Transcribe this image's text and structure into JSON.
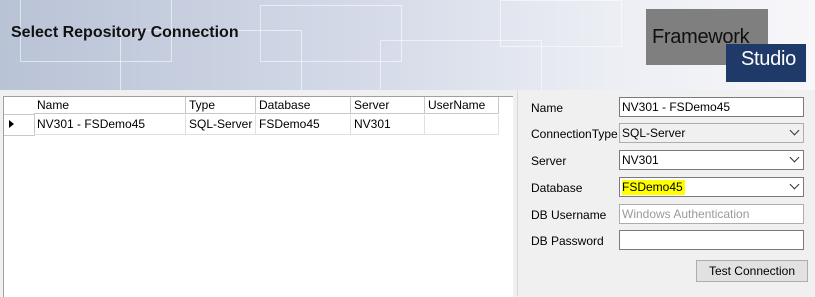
{
  "header": {
    "title": "Select Repository Connection",
    "logo_line1": "Framework",
    "logo_line2": "Studio"
  },
  "grid": {
    "columns": [
      "Name",
      "Type",
      "Database",
      "Server",
      "UserName"
    ],
    "rows": [
      [
        "NV301 - FSDemo45",
        "SQL-Server",
        "FSDemo45",
        "NV301",
        ""
      ]
    ]
  },
  "form": {
    "name_label": "Name",
    "name_value": "NV301 - FSDemo45",
    "connection_type_label": "ConnectionType",
    "connection_type_value": "SQL-Server",
    "server_label": "Server",
    "server_value": "NV301",
    "database_label": "Database",
    "database_value": "FSDemo45",
    "db_username_label": "DB Username",
    "db_username_placeholder": "Windows Authentication",
    "db_password_label": "DB Password",
    "db_password_value": "",
    "test_connection_label": "Test Connection"
  },
  "colors": {
    "highlight": "#ffff00",
    "logo_navy": "#1f3a68",
    "logo_gray": "#7f7f7f"
  }
}
